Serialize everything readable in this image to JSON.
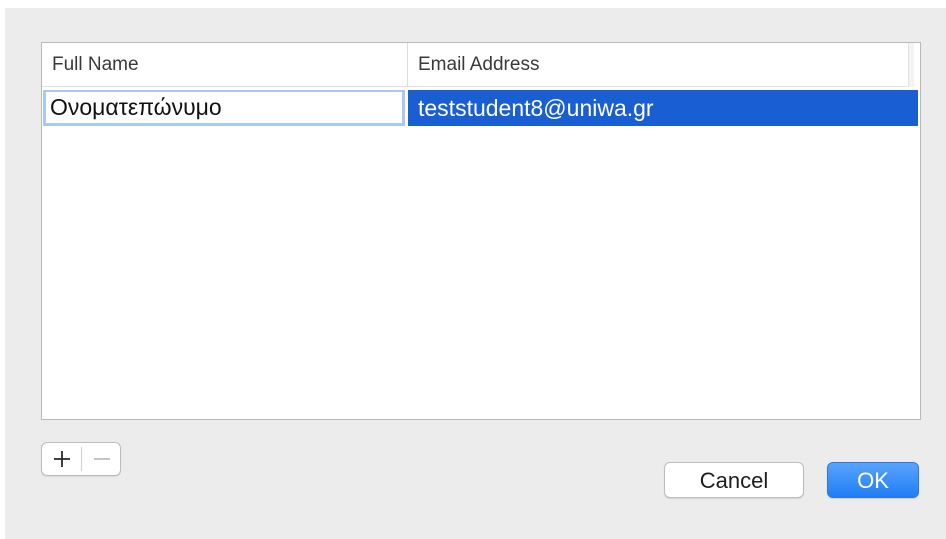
{
  "table": {
    "columns": [
      {
        "label": "Full Name"
      },
      {
        "label": "Email Address"
      }
    ],
    "rows": [
      {
        "full_name": "Ονοματεπώνυμο",
        "email": "teststudent8@uniwa.gr",
        "selected": true
      }
    ]
  },
  "controls": {
    "add_icon": "plus-icon",
    "remove_icon": "minus-icon"
  },
  "buttons": {
    "cancel_label": "Cancel",
    "ok_label": "OK"
  },
  "colors": {
    "selection": "#1a5ed3",
    "accent": "#1f7ef5",
    "sheet_background": "#ececec"
  }
}
